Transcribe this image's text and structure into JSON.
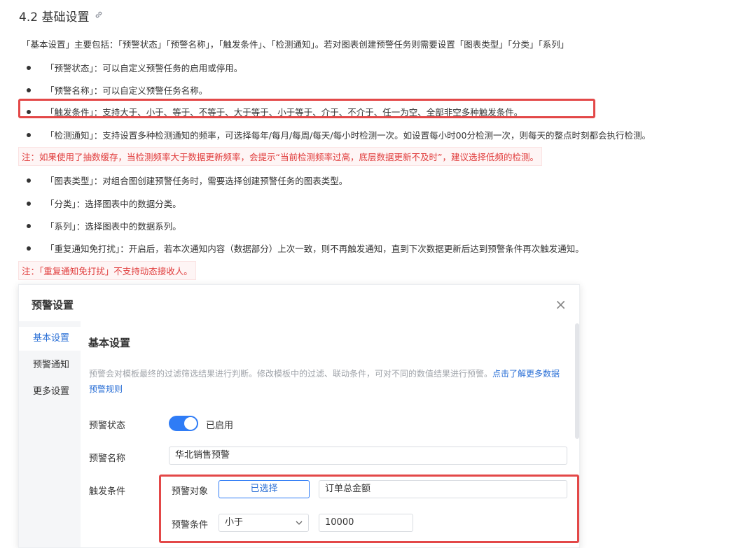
{
  "doc": {
    "heading": "4.2 基础设置",
    "intro": "「基本设置」主要包括：「预警状态」「预警名称」，「触发条件」、「检测通知」。若对图表创建预警任务则需要设置「图表类型」「分类」「系列」",
    "bullets": [
      "「预警状态」：可以自定义预警任务的启用或停用。",
      "「预警名称」：可以自定义预警任务名称。",
      "「触发条件」：支持大于、小于、等于、不等于、大于等于、小于等于、介于、不介于、任一为空、全部非空多种触发条件。",
      "「检测通知」：支持设置多种检测通知的频率，可选择每年/每月/每周/每天/每小时检测一次。如设置每小时00分检测一次，则每天的整点时刻都会执行检测。",
      "「图表类型」：对组合图创建预警任务时，需要选择创建预警任务的图表类型。",
      "「分类」：选择图表中的数据分类。",
      "「系列」：选择图表中的数据系列。",
      "「重复通知免打扰」：开启后，若本次通知内容（数据部分）上次一致，则不再触发通知，直到下次数据更新后达到预警条件再次触发通知。"
    ],
    "note1": "注：如果使用了抽数缓存，当检测频率大于数据更新频率，会提示“当前检测频率过高，底层数据更新不及时”，建议选择低频的检测。",
    "note2": "注：「重复通知免打扰」不支持动态接收人。"
  },
  "dialog": {
    "title": "预警设置",
    "close": "×",
    "tabs": [
      "基本设置",
      "预警通知",
      "更多设置"
    ],
    "section_title": "基本设置",
    "description": "预警会对模板最终的过滤筛选结果进行判断。修改模板中的过滤、联动条件，可对不同的数值结果进行预警。",
    "description_link": "点击了解更多数据预警规则",
    "status_label": "预警状态",
    "status_value": "已启用",
    "name_label": "预警名称",
    "name_value": "华北销售预警",
    "trigger_label": "触发条件",
    "target_label": "预警对象",
    "target_button": "已选择",
    "target_value": "订单总金额",
    "condition_label": "预警条件",
    "condition_select": "小于",
    "condition_value": "10000"
  },
  "colors": {
    "accent": "#2f7cf6",
    "highlight": "#e34848",
    "note": "#e03b3b"
  }
}
